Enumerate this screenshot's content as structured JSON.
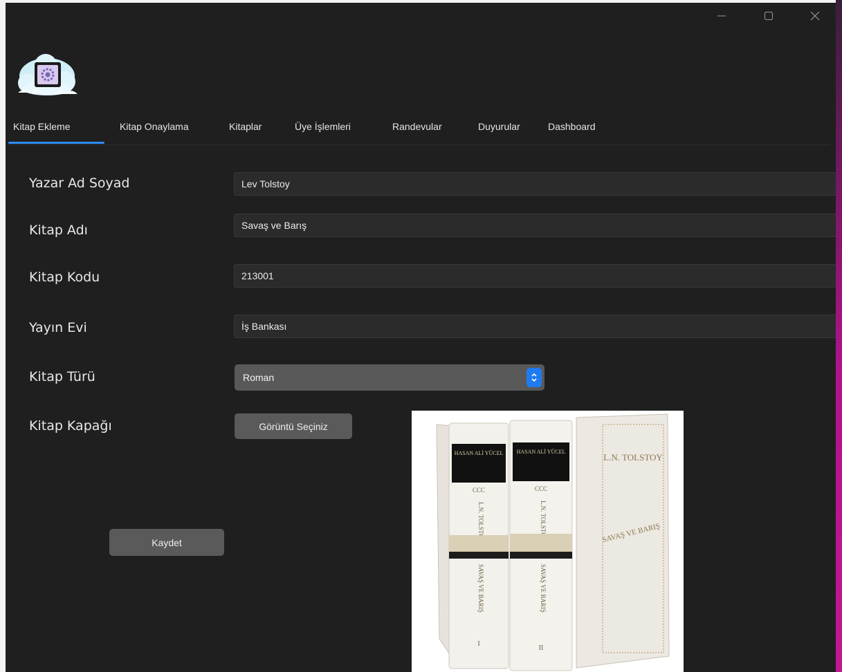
{
  "tabs": [
    "Kitap Ekleme",
    "Kitap Onaylama",
    "Kitaplar",
    "Üye İşlemleri",
    "Randevular",
    "Duyurular",
    "Dashboard"
  ],
  "form": {
    "author_label": "Yazar Ad Soyad",
    "author_value": "Lev Tolstoy",
    "title_label": "Kitap Adı",
    "title_value": "Savaş ve Barış",
    "code_label": "Kitap Kodu",
    "code_value": "213001",
    "publisher_label": "Yayın Evi",
    "publisher_value": "İş Bankası",
    "genre_label": "Kitap Türü",
    "genre_value": "Roman",
    "cover_label": "Kitap Kapağı",
    "choose_image_label": "Görüntü Seçiniz",
    "save_label": "Kaydet"
  },
  "cover_art": {
    "publisher_mark": "HASAN ALİ YÜCEL",
    "series": "CCC",
    "author": "L.N. TOLSTOY",
    "title": "SAVAŞ VE BARIŞ",
    "volumes": [
      "I",
      "II"
    ]
  },
  "colors": {
    "accent": "#2f8cff",
    "background": "#1f1f1f"
  }
}
